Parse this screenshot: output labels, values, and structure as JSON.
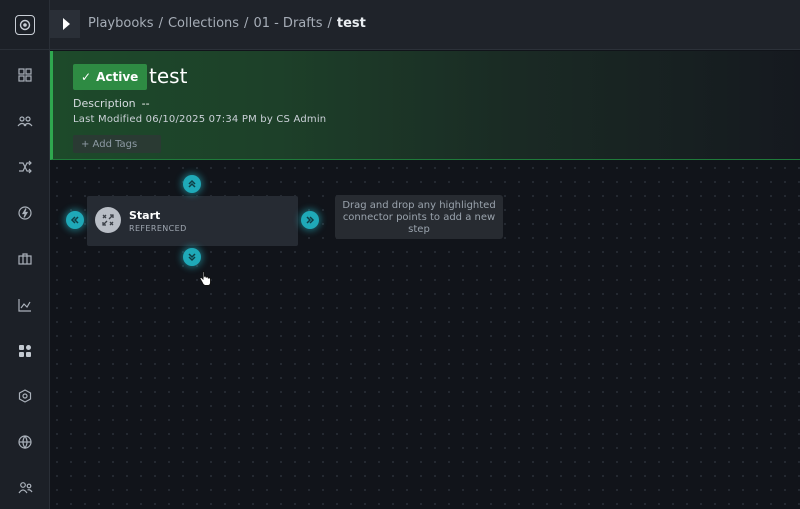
{
  "breadcrumb": {
    "items": [
      "Playbooks",
      "Collections",
      "01 - Drafts"
    ],
    "current": "test"
  },
  "playbook": {
    "status": "Active",
    "title": "test",
    "description_label": "Description",
    "description_value": "--",
    "last_modified": "Last Modified 06/10/2025 07:34 PM by CS Admin",
    "add_tags_label": "+ Add Tags"
  },
  "step": {
    "title": "Start",
    "subtitle": "REFERENCED"
  },
  "hint": {
    "line1": "Drag and drop any highlighted",
    "line2": "connector points to add a new",
    "line3": "step"
  },
  "icons": {
    "rail": [
      "logo-icon",
      "dashboard-icon",
      "people-icon",
      "shuffle-icon",
      "bolt-icon",
      "briefcase-icon",
      "chart-icon",
      "apps-icon",
      "network-icon",
      "globe-icon",
      "users-icon"
    ]
  },
  "colors": {
    "accent": "#1fa9b8",
    "active": "#2e8b43"
  }
}
